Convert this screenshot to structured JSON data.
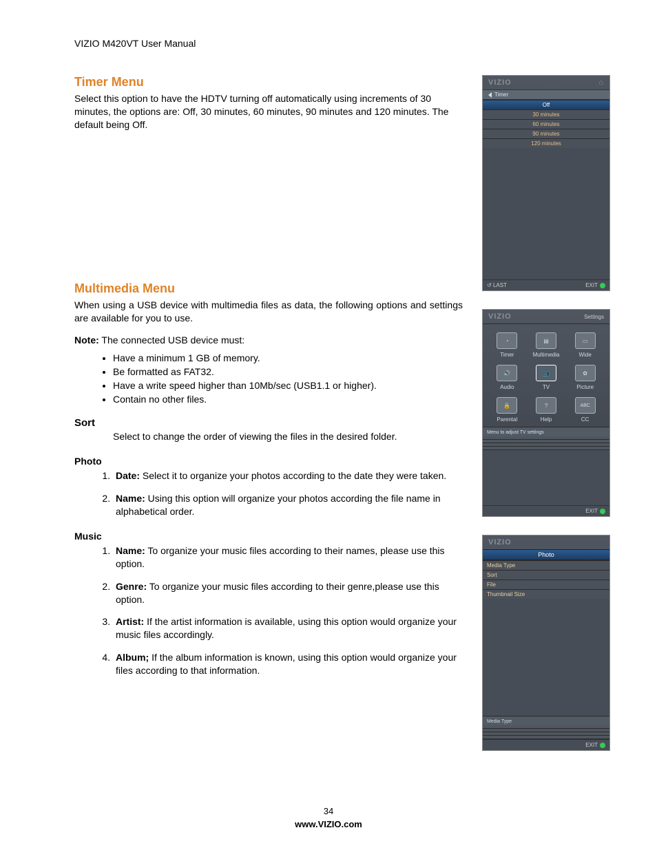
{
  "header": "VIZIO M420VT User Manual",
  "sections": {
    "timer": {
      "title": "Timer Menu",
      "body": "Select this option to have the HDTV turning off automatically using increments of 30 minutes, the options are: Off, 30 minutes, 60 minutes, 90 minutes and 120 minutes. The default being Off."
    },
    "multimedia": {
      "title": "Multimedia Menu",
      "intro": "When using a USB device with multimedia files as data, the following options and settings are available for you to use.",
      "note_label": "Note:",
      "note_text": " The connected USB device must:",
      "reqs": [
        "Have a minimum 1 GB of memory.",
        "Be formatted as FAT32.",
        "Have a write speed higher than 10Mb/sec (USB1.1 or higher).",
        "Contain no other files."
      ],
      "sort": {
        "title": "Sort",
        "body": "Select to change the order of viewing the files in the desired folder."
      },
      "photo": {
        "title": "Photo",
        "items": [
          {
            "label": "Date:",
            "text": " Select it to organize your photos according to the date they were taken."
          },
          {
            "label": "Name:",
            "text": " Using this option will organize your photos according the file name in alphabetical order."
          }
        ]
      },
      "music": {
        "title": "Music",
        "items": [
          {
            "label": "Name:",
            "text": " To organize your music files according to their names, please use this option."
          },
          {
            "label": "Genre:",
            "text": " To organize your music files according to their genre,please use this option."
          },
          {
            "label": "Artist:",
            "text": "  If the artist information is available, using this option would organize your music files accordingly."
          },
          {
            "label": "Album;",
            "text": " If the album information is known, using this option would organize your files according to that information."
          }
        ]
      }
    }
  },
  "footer": {
    "page": "34",
    "url": "www.VIZIO.com"
  },
  "osd1": {
    "brand": "VIZIO",
    "tab": "Timer",
    "rows": [
      "Off",
      "30 minutes",
      "60 minutes",
      "90 minutes",
      "120 minutes"
    ],
    "last": "LAST",
    "exit": "EXIT"
  },
  "osd2": {
    "brand": "VIZIO",
    "right": "Settings",
    "cells": [
      "Timer",
      "Multimedia",
      "Wide",
      "Audio",
      "TV",
      "Picture",
      "Parental",
      "Help",
      "CC"
    ],
    "hint": "Menu to adjust TV settings",
    "exit": "EXIT"
  },
  "osd3": {
    "brand": "VIZIO",
    "title": "Photo",
    "rows": [
      "Media Type",
      "Sort",
      "File",
      "Thumbnail Size"
    ],
    "bottom_label": "Media Type",
    "exit": "EXIT"
  }
}
